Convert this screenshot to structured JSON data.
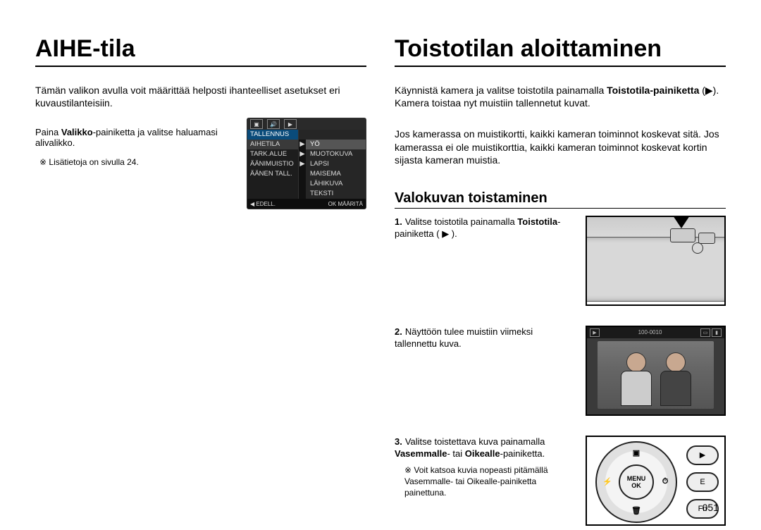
{
  "page_number": "051",
  "left": {
    "title": "AIHE-tila",
    "intro": "Tämän valikon avulla voit määrittää helposti ihanteelliset asetukset eri kuvaustilanteisiin.",
    "instruction_pre": "Paina ",
    "instruction_bold": "Valikko",
    "instruction_post": "-painiketta ja valitse haluamasi alivalikko.",
    "note": "Lisätietoja on sivulla 24.",
    "menu": {
      "header": "TALLENNUS",
      "left_items": [
        "AIHETILA",
        "TARK.ALUE",
        "ÄÄNIMUISTIO",
        "ÄÄNEN TALL."
      ],
      "right_items": [
        "YÖ",
        "MUOTOKUVA",
        "LAPSI",
        "MAISEMA",
        "LÄHIKUVA",
        "TEKSTI"
      ],
      "foot_left": "◀  EDELL.",
      "foot_right": "OK  MÄÄRITÄ"
    }
  },
  "right": {
    "title": "Toistotilan aloittaminen",
    "intro_part1": "Käynnistä kamera ja valitse toistotila painamalla ",
    "intro_bold": "Toistotila-painiketta",
    "intro_part2": " (▶). Kamera toistaa nyt muistiin tallennetut kuvat.",
    "intro_para2": "Jos kamerassa on muistikortti, kaikki kameran toiminnot koskevat sitä. Jos kamerassa ei ole muistikorttia, kaikki kameran toiminnot koskevat kortin sijasta kameran muistia.",
    "section": "Valokuvan toistaminen",
    "steps": {
      "s1_pre": "Valitse toistotila painamalla ",
      "s1_bold": "Toistotila",
      "s1_post": "-painiketta ( ▶ ).",
      "s2": "Näyttöön tulee muistiin viimeksi tallennettu kuva.",
      "s3_pre": "Valitse toistettava kuva painamalla ",
      "s3_bold1": "Vasemmalle",
      "s3_mid": "- tai ",
      "s3_bold2": "Oikealle",
      "s3_post": "-painiketta.",
      "s3_note": "Voit katsoa kuvia nopeasti pitämällä Vasemmalle- tai Oikealle-painiketta painettuna."
    },
    "photo_bar": {
      "counter": "100-0010"
    },
    "wheel_center_l1": "MENU",
    "wheel_center_l2": "OK"
  }
}
